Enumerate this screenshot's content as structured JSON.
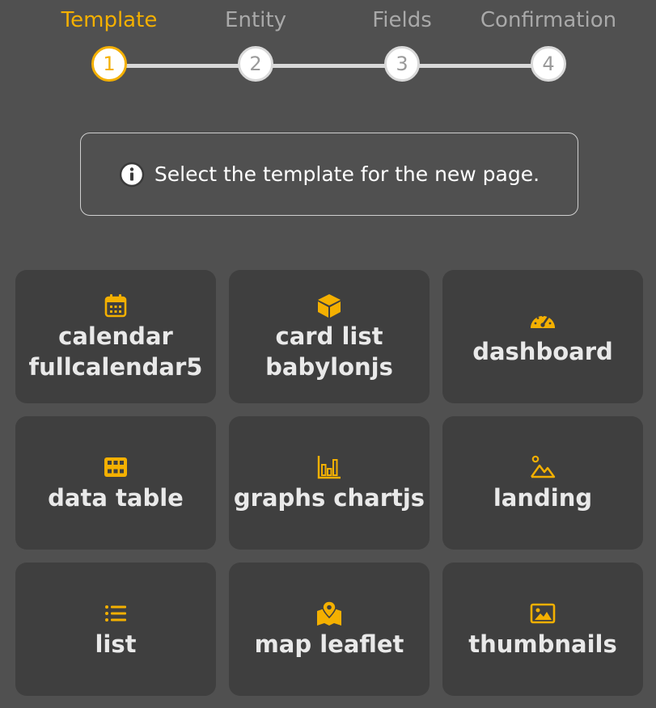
{
  "accent_color": "#f4b000",
  "steps": [
    {
      "label": "Template",
      "number": "1",
      "state": "active"
    },
    {
      "label": "Entity",
      "number": "2",
      "state": "inactive"
    },
    {
      "label": "Fields",
      "number": "3",
      "state": "inactive"
    },
    {
      "label": "Confirmation",
      "number": "4",
      "state": "inactive"
    }
  ],
  "info": {
    "icon": "info-icon",
    "text": "Select the template for the new page."
  },
  "templates": [
    {
      "label": "calendar\nfullcalendar5",
      "icon": "calendar-icon"
    },
    {
      "label": "card list\nbabylonjs",
      "icon": "cube-icon"
    },
    {
      "label": "dashboard",
      "icon": "gauge-icon"
    },
    {
      "label": "data table",
      "icon": "table-icon"
    },
    {
      "label": "graphs chartjs",
      "icon": "bar-chart-icon"
    },
    {
      "label": "landing",
      "icon": "mountain-icon"
    },
    {
      "label": "list",
      "icon": "list-icon"
    },
    {
      "label": "map leaflet",
      "icon": "map-marker-icon"
    },
    {
      "label": "thumbnails",
      "icon": "image-icon"
    }
  ]
}
